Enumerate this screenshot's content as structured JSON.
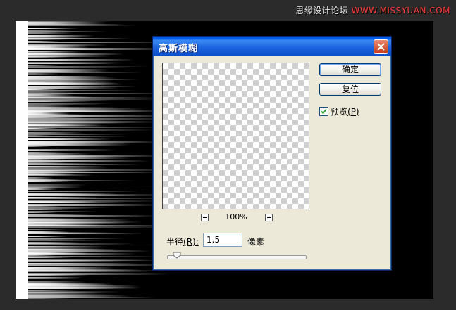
{
  "watermark": {
    "site_cn": "思缘设计论坛",
    "site_url": "WWW.MISSYUAN.COM"
  },
  "dialog": {
    "title": "高斯模糊",
    "ok_label": "确定",
    "reset_label": "复位",
    "preview_label": "预览",
    "preview_hotkey": "(P)",
    "preview_checked": true,
    "zoom_level": "100%",
    "radius_label": "半径",
    "radius_hotkey": "(R):",
    "radius_value": "1.5",
    "radius_unit": "像素",
    "slider_fraction": 0.07
  },
  "colors": {
    "titlebar": "#0a5ce6",
    "dialog_bg": "#ece9d8",
    "canvas_bg": "#000000",
    "close_button": "#c6381a",
    "watermark_accent": "#ff3b3b"
  }
}
